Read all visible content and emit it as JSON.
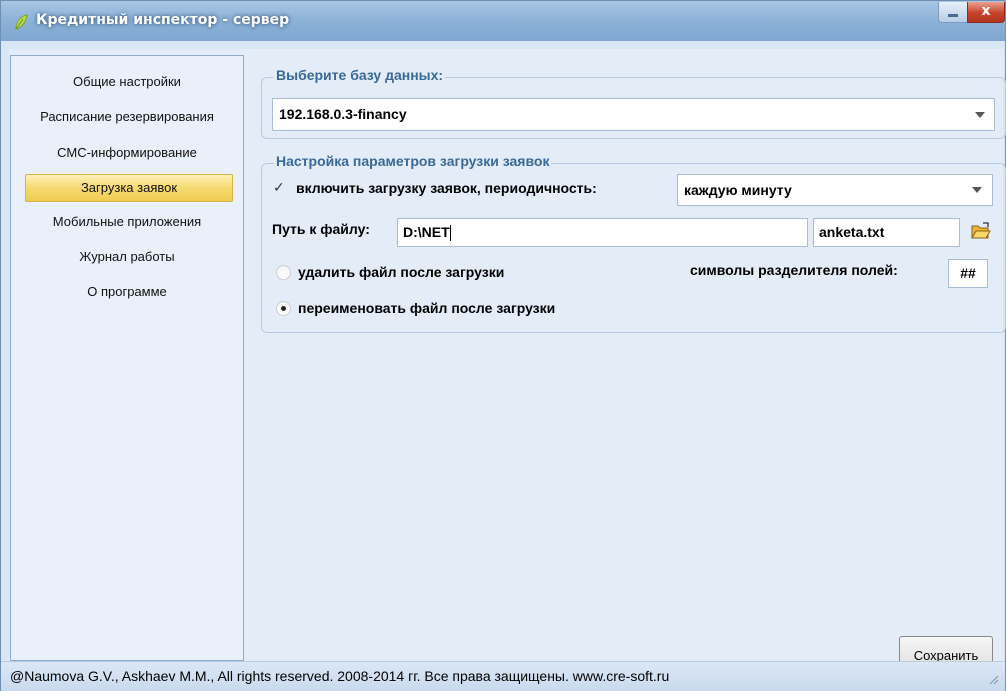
{
  "window": {
    "title": "Кредитный инспектор - сервер",
    "close_label": "x"
  },
  "sidebar": {
    "items": [
      {
        "label": "Общие настройки"
      },
      {
        "label": "Расписание резервирования"
      },
      {
        "label": "СМС-информирование"
      },
      {
        "label": "Загрузка заявок",
        "active": true
      },
      {
        "label": "Мобильные приложения"
      },
      {
        "label": "Журнал работы"
      },
      {
        "label": "О программе"
      }
    ]
  },
  "database": {
    "legend": "Выберите базу данных:",
    "selected": "192.168.0.3-financy"
  },
  "load": {
    "legend": "Настройка параметров загрузки заявок",
    "enable_label": "включить загрузку заявок, периодичность:",
    "enable_checked": true,
    "period_value": "каждую минуту",
    "path_label": "Путь к файлу:",
    "path_value": "D:\\NET",
    "file_name": "anketa.txt",
    "delete_label": "удалить файл после загрузки",
    "rename_label": "переименовать файл после загрузки",
    "separator_label": "символы разделителя полей:",
    "separator_value": "##"
  },
  "actions": {
    "save_label": "Сохранить"
  },
  "status": {
    "text": "@Naumova G.V., Askhaev M.M., All rights reserved. 2008-2014 гг. Все права защищены. www.cre-soft.ru"
  }
}
